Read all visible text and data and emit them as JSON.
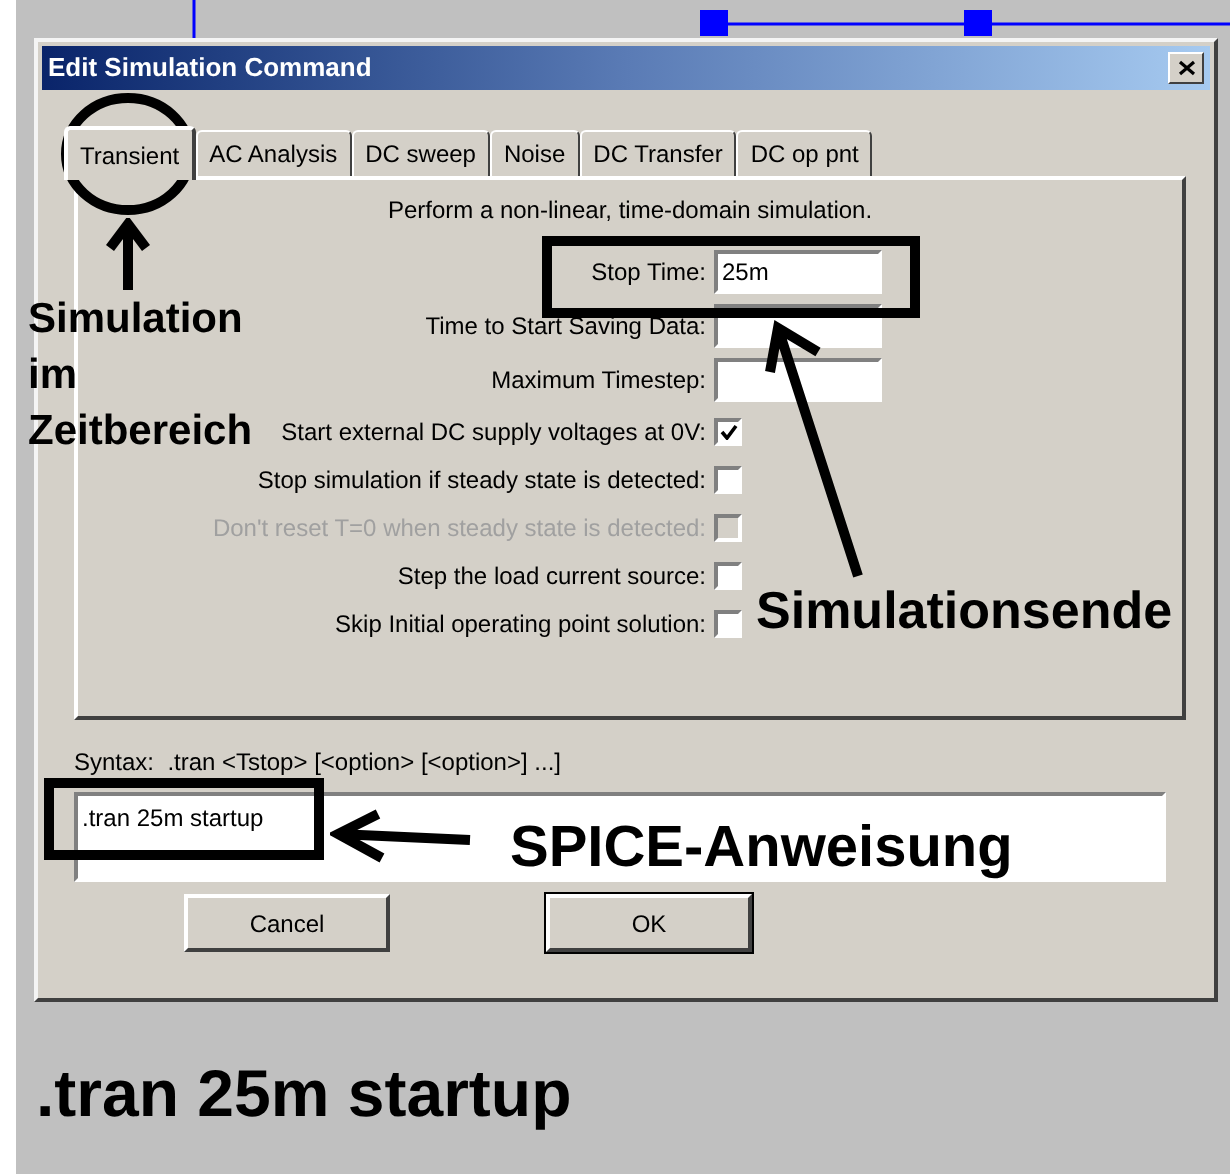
{
  "dialog": {
    "title": "Edit Simulation Command",
    "tabs": [
      {
        "label": "Transient",
        "selected": true
      },
      {
        "label": "AC Analysis",
        "selected": false
      },
      {
        "label": "DC sweep",
        "selected": false
      },
      {
        "label": "Noise",
        "selected": false
      },
      {
        "label": "DC Transfer",
        "selected": false
      },
      {
        "label": "DC op pnt",
        "selected": false
      }
    ],
    "description": "Perform a non-linear, time-domain simulation.",
    "rows": [
      {
        "kind": "field",
        "label": "Stop Time:",
        "value": "25m"
      },
      {
        "kind": "field",
        "label": "Time to Start Saving Data:"
      },
      {
        "kind": "field",
        "label": "Maximum Timestep:"
      },
      {
        "kind": "checkbox",
        "label": "Start external DC supply voltages at 0V:",
        "checked": true,
        "disabled": false
      },
      {
        "kind": "checkbox",
        "label": "Stop simulation if steady state is detected:",
        "checked": false,
        "disabled": false
      },
      {
        "kind": "checkbox",
        "label": "Don't reset T=0 when steady state is detected:",
        "checked": false,
        "disabled": true
      },
      {
        "kind": "checkbox",
        "label": "Step the load current source:",
        "checked": false,
        "disabled": false
      },
      {
        "kind": "checkbox",
        "label": "Skip Initial operating point solution:",
        "checked": false,
        "disabled": false
      }
    ],
    "syntax": "Syntax:  .tran <Tstop> [<option> [<option>] ...]",
    "command": ".tran 25m startup",
    "buttons": [
      "Cancel",
      "OK"
    ]
  },
  "annotations": {
    "tab_note": "Simulation im Zeitbereich",
    "stop_note": "Simulationsende",
    "command_note": "SPICE-Anweisung",
    "footer": ".tran 25m startup"
  }
}
